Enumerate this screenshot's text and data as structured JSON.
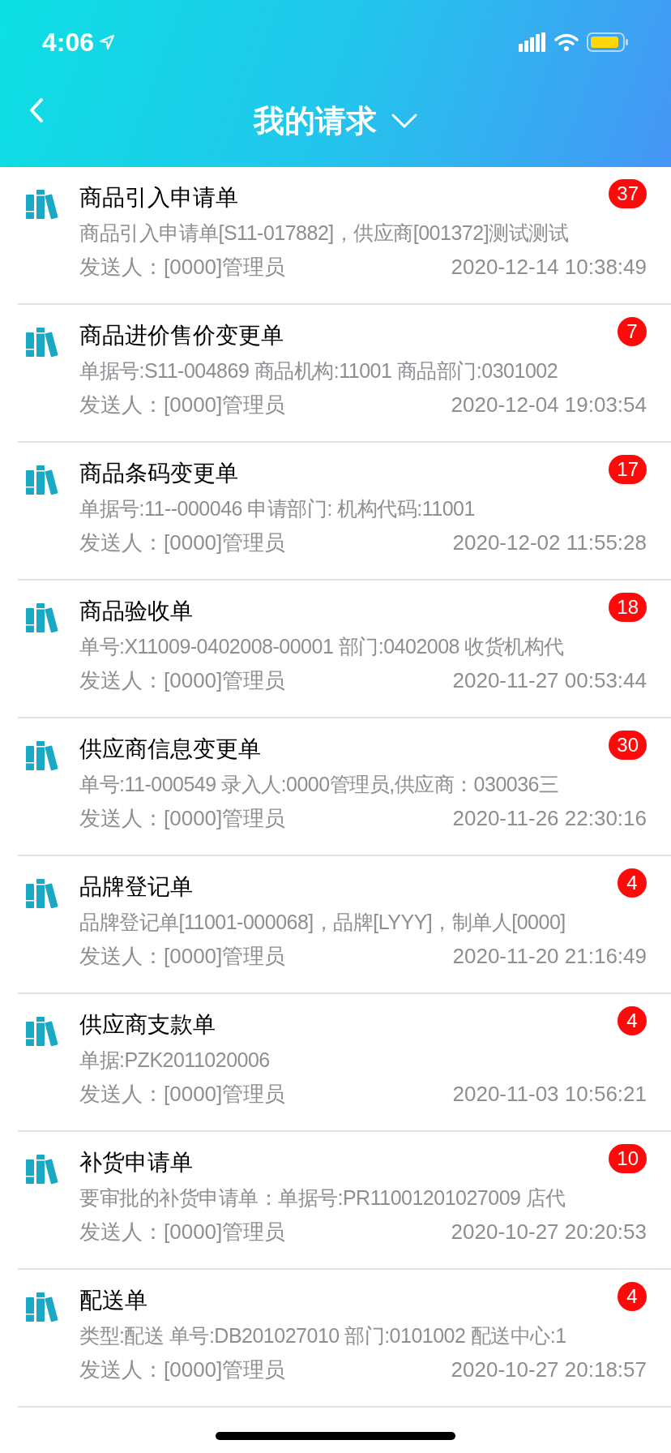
{
  "status_bar": {
    "time": "4:06"
  },
  "header": {
    "title": "我的请求"
  },
  "items": [
    {
      "title": "商品引入申请单",
      "badge": "37",
      "summary": "商品引入申请单[S11-017882]，供应商[001372]测试测试",
      "sender": "发送人：[0000]管理员",
      "time": "2020-12-14 10:38:49"
    },
    {
      "title": "商品进价售价变更单",
      "badge": "7",
      "summary": "单据号:S11-004869 商品机构:11001 商品部门:0301002",
      "sender": "发送人：[0000]管理员",
      "time": "2020-12-04 19:03:54"
    },
    {
      "title": "商品条码变更单",
      "badge": "17",
      "summary": "单据号:11--000046 申请部门: 机构代码:11001",
      "sender": "发送人：[0000]管理员",
      "time": "2020-12-02 11:55:28"
    },
    {
      "title": "商品验收单",
      "badge": "18",
      "summary": "单号:X11009-0402008-00001 部门:0402008 收货机构代",
      "sender": "发送人：[0000]管理员",
      "time": "2020-11-27 00:53:44"
    },
    {
      "title": "供应商信息变更单",
      "badge": "30",
      "summary": "单号:11-000549 录入人:0000管理员,供应商：030036三",
      "sender": "发送人：[0000]管理员",
      "time": "2020-11-26 22:30:16"
    },
    {
      "title": "品牌登记单",
      "badge": "4",
      "summary": "品牌登记单[11001-000068]，品牌[LYYY]，制单人[0000]",
      "sender": "发送人：[0000]管理员",
      "time": "2020-11-20 21:16:49"
    },
    {
      "title": "供应商支款单",
      "badge": "4",
      "summary": "单据:PZK2011020006",
      "sender": "发送人：[0000]管理员",
      "time": "2020-11-03 10:56:21"
    },
    {
      "title": "补货申请单",
      "badge": "10",
      "summary": "要审批的补货申请单：单据号:PR11001201027009 店代",
      "sender": "发送人：[0000]管理员",
      "time": "2020-10-27 20:20:53"
    },
    {
      "title": "配送单",
      "badge": "4",
      "summary": "类型:配送 单号:DB201027010 部门:0101002 配送中心:1",
      "sender": "发送人：[0000]管理员",
      "time": "2020-10-27 20:18:57"
    }
  ]
}
